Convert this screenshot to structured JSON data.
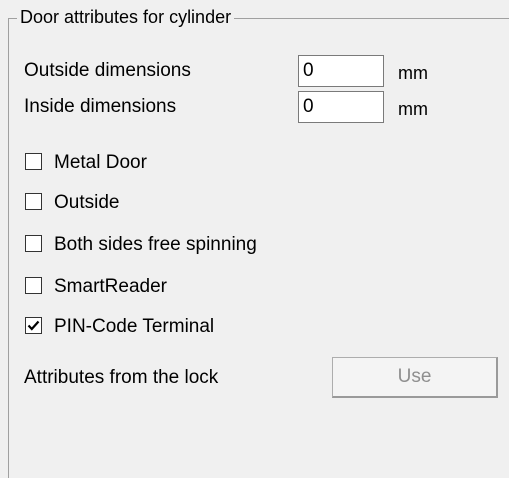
{
  "group": {
    "title": "Door attributes for cylinder"
  },
  "dimensions": {
    "outside_label": "Outside dimensions",
    "outside_value": "0",
    "outside_unit": "mm",
    "inside_label": "Inside dimensions",
    "inside_value": "0",
    "inside_unit": "mm"
  },
  "checkboxes": [
    {
      "label": "Metal Door",
      "checked": false
    },
    {
      "label": "Outside",
      "checked": false
    },
    {
      "label": "Both sides free spinning",
      "checked": false
    },
    {
      "label": "SmartReader",
      "checked": false
    },
    {
      "label": "PIN-Code Terminal",
      "checked": true
    }
  ],
  "lock_attributes": {
    "label": "Attributes from the lock",
    "button_label": "Use",
    "button_enabled": false
  },
  "icons": {
    "check": "check-mark-icon"
  },
  "colors": {
    "background": "#f0f0f0",
    "disabled_text": "#8f8f8f"
  }
}
